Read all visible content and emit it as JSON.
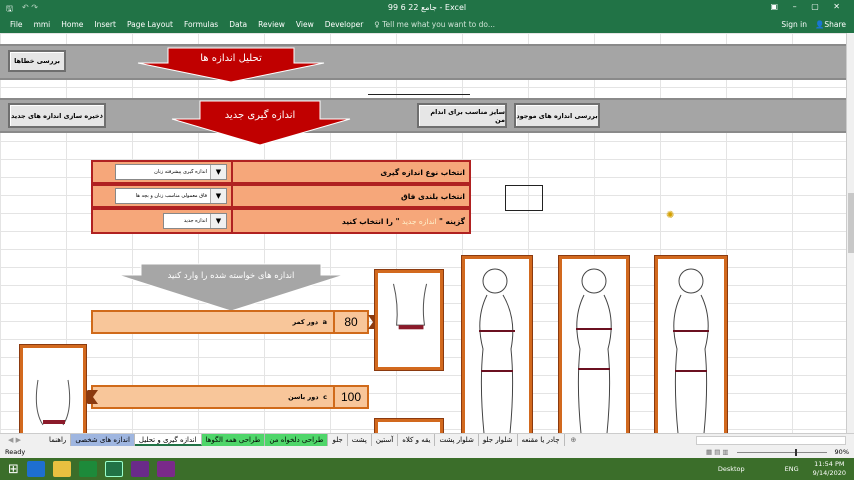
{
  "window": {
    "title": "99 6 22 جامع - Excel"
  },
  "ribbon": {
    "tabs": [
      "File",
      "mmi",
      "Home",
      "Insert",
      "Page Layout",
      "Formulas",
      "Data",
      "Review",
      "View",
      "Developer"
    ],
    "tell_me": "Tell me what you want to do...",
    "sign_in": "Sign in",
    "share": "Share"
  },
  "sheet": {
    "check_errors_button": "بررسی خطاها",
    "analysis_arrow": "تحلیل اندازه ها",
    "save_new_button": "ذخیره سازی اندازه های جدید",
    "new_measure_arrow": "اندازه گیری جدید",
    "fit_size_button": "سایز مناسب برای اندام من",
    "review_existing_button": "بررسی اندازه های موجود",
    "rows": [
      {
        "label": "انتخاب نوع اندازه گیری",
        "value": "اندازه گیری پیشرفته زنان"
      },
      {
        "label": "انتخاب بلندی فاق",
        "value": "فاق معمولی مناسب زنان و بچه ها"
      },
      {
        "label_pre": "گزینه \"",
        "label_highlight": " اندازه جدید ",
        "label_post": "\" را انتخاب کنید",
        "value": "اندازه جدید"
      }
    ],
    "enter_arrow": "اندازه های خواسته شده را وارد کنید",
    "measurements": [
      {
        "code": "a",
        "label": "دور کمر",
        "value": "80"
      },
      {
        "code": "c",
        "label": "دور باسن",
        "value": "100"
      }
    ]
  },
  "sheet_tabs": [
    {
      "label": "راهنما",
      "style": "normal"
    },
    {
      "label": "اندازه های شخصی",
      "style": "blue"
    },
    {
      "label": "اندازه گیری و تحلیل",
      "style": "active"
    },
    {
      "label": "طراحی همه الگوها",
      "style": "green"
    },
    {
      "label": "طراحی دلخواه من",
      "style": "green"
    },
    {
      "label": "جلو",
      "style": "normal"
    },
    {
      "label": "پشت",
      "style": "normal"
    },
    {
      "label": "آستین",
      "style": "normal"
    },
    {
      "label": "یقه و کلاه",
      "style": "normal"
    },
    {
      "label": "شلوار پشت",
      "style": "normal"
    },
    {
      "label": "شلوار جلو",
      "style": "normal"
    },
    {
      "label": "چادر یا مقنعه",
      "style": "normal"
    }
  ],
  "status": {
    "ready": "Ready",
    "zoom": "90%"
  },
  "taskbar": {
    "desktop": "Desktop",
    "lang": "ENG",
    "time": "11:54 PM",
    "date": "9/14/2020"
  },
  "colors": {
    "excel_green": "#217346",
    "red_arrow": "#c00000",
    "row_fill": "#f6a77a",
    "row_border": "#b02121",
    "measure_fill": "#f8c69a",
    "highlight_text": "#fff2cc"
  }
}
